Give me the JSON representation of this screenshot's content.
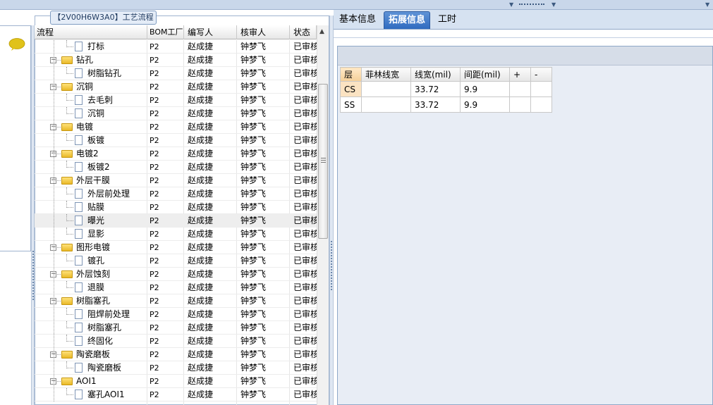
{
  "process_panel": {
    "title": "【2V00H6W3A0】工艺流程",
    "columns": {
      "flow": "流程",
      "bom_factory": "BOM工厂",
      "writer": "编写人",
      "reviewer": "核审人",
      "status": "状态"
    },
    "rows": [
      {
        "name": "打标",
        "kind": "item",
        "factory": "P2",
        "writer": "赵成捷",
        "reviewer": "钟梦飞",
        "status": "已审核"
      },
      {
        "name": "钻孔",
        "kind": "group",
        "factory": "P2",
        "writer": "赵成捷",
        "reviewer": "钟梦飞",
        "status": "已审核"
      },
      {
        "name": "树脂钻孔",
        "kind": "item",
        "factory": "P2",
        "writer": "赵成捷",
        "reviewer": "钟梦飞",
        "status": "已审核"
      },
      {
        "name": "沉铜",
        "kind": "group",
        "factory": "P2",
        "writer": "赵成捷",
        "reviewer": "钟梦飞",
        "status": "已审核"
      },
      {
        "name": "去毛刺",
        "kind": "item",
        "factory": "P2",
        "writer": "赵成捷",
        "reviewer": "钟梦飞",
        "status": "已审核"
      },
      {
        "name": "沉铜",
        "kind": "item",
        "factory": "P2",
        "writer": "赵成捷",
        "reviewer": "钟梦飞",
        "status": "已审核"
      },
      {
        "name": "电镀",
        "kind": "group",
        "factory": "P2",
        "writer": "赵成捷",
        "reviewer": "钟梦飞",
        "status": "已审核"
      },
      {
        "name": "板镀",
        "kind": "item",
        "factory": "P2",
        "writer": "赵成捷",
        "reviewer": "钟梦飞",
        "status": "已审核"
      },
      {
        "name": "电镀2",
        "kind": "group",
        "factory": "P2",
        "writer": "赵成捷",
        "reviewer": "钟梦飞",
        "status": "已审核"
      },
      {
        "name": "板镀2",
        "kind": "item",
        "factory": "P2",
        "writer": "赵成捷",
        "reviewer": "钟梦飞",
        "status": "已审核"
      },
      {
        "name": "外层干膜",
        "kind": "group",
        "factory": "P2",
        "writer": "赵成捷",
        "reviewer": "钟梦飞",
        "status": "已审核"
      },
      {
        "name": "外层前处理",
        "kind": "item",
        "factory": "P2",
        "writer": "赵成捷",
        "reviewer": "钟梦飞",
        "status": "已审核"
      },
      {
        "name": "贴膜",
        "kind": "item",
        "factory": "P2",
        "writer": "赵成捷",
        "reviewer": "钟梦飞",
        "status": "已审核"
      },
      {
        "name": "曝光",
        "kind": "item",
        "factory": "P2",
        "writer": "赵成捷",
        "reviewer": "钟梦飞",
        "status": "已审核",
        "selected": true
      },
      {
        "name": "显影",
        "kind": "item",
        "factory": "P2",
        "writer": "赵成捷",
        "reviewer": "钟梦飞",
        "status": "已审核"
      },
      {
        "name": "图形电镀",
        "kind": "group",
        "factory": "P2",
        "writer": "赵成捷",
        "reviewer": "钟梦飞",
        "status": "已审核"
      },
      {
        "name": "镀孔",
        "kind": "item",
        "factory": "P2",
        "writer": "赵成捷",
        "reviewer": "钟梦飞",
        "status": "已审核"
      },
      {
        "name": "外层蚀刻",
        "kind": "group",
        "factory": "P2",
        "writer": "赵成捷",
        "reviewer": "钟梦飞",
        "status": "已审核"
      },
      {
        "name": "退膜",
        "kind": "item",
        "factory": "P2",
        "writer": "赵成捷",
        "reviewer": "钟梦飞",
        "status": "已审核"
      },
      {
        "name": "树脂塞孔",
        "kind": "group",
        "factory": "P2",
        "writer": "赵成捷",
        "reviewer": "钟梦飞",
        "status": "已审核"
      },
      {
        "name": "阻焊前处理",
        "kind": "item",
        "factory": "P2",
        "writer": "赵成捷",
        "reviewer": "钟梦飞",
        "status": "已审核"
      },
      {
        "name": "树脂塞孔",
        "kind": "item",
        "factory": "P2",
        "writer": "赵成捷",
        "reviewer": "钟梦飞",
        "status": "已审核"
      },
      {
        "name": "终固化",
        "kind": "item",
        "factory": "P2",
        "writer": "赵成捷",
        "reviewer": "钟梦飞",
        "status": "已审核"
      },
      {
        "name": "陶瓷磨板",
        "kind": "group",
        "factory": "P2",
        "writer": "赵成捷",
        "reviewer": "钟梦飞",
        "status": "已审核"
      },
      {
        "name": "陶瓷磨板",
        "kind": "item",
        "factory": "P2",
        "writer": "赵成捷",
        "reviewer": "钟梦飞",
        "status": "已审核"
      },
      {
        "name": "AOI1",
        "kind": "group",
        "factory": "P2",
        "writer": "赵成捷",
        "reviewer": "钟梦飞",
        "status": "已审核"
      },
      {
        "name": "塞孔AOI1",
        "kind": "item",
        "factory": "P2",
        "writer": "赵成捷",
        "reviewer": "钟梦飞",
        "status": "已审核"
      }
    ]
  },
  "tabs": [
    {
      "label": "基本信息",
      "active": false
    },
    {
      "label": "拓展信息",
      "active": true
    },
    {
      "label": "工时",
      "active": false
    }
  ],
  "layer_table": {
    "headers": [
      "层",
      "菲林线宽",
      "线宽(mil)",
      "间距(mil)",
      "+",
      "-"
    ],
    "rows": [
      {
        "layer": "CS",
        "film": "",
        "width": "33.72",
        "spacing": "9.9",
        "plus": "",
        "minus": ""
      },
      {
        "layer": "SS",
        "film": "",
        "width": "33.72",
        "spacing": "9.9",
        "plus": "",
        "minus": ""
      }
    ]
  },
  "colors": {
    "active_tab": "#3a76c8",
    "layer_highlight": "#fbe3c2",
    "folder": "#f3c84a"
  },
  "icons": {
    "left_panel": "speech-bubble-icon",
    "group": "folder-icon",
    "item": "document-icon",
    "toggle": "collapse-minus-icon"
  }
}
